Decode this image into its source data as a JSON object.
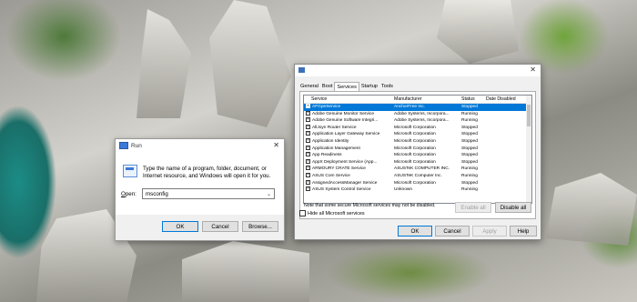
{
  "run_dialog": {
    "title": "Run",
    "message": "Type the name of a program, folder, document, or Internet resource, and Windows will open it for you.",
    "open_label": "Open:",
    "open_value": "msconfig",
    "ok": "OK",
    "cancel": "Cancel",
    "browse": "Browse..."
  },
  "msconfig": {
    "tabs": [
      "General",
      "Boot",
      "Services",
      "Startup",
      "Tools"
    ],
    "active_tab": "Services",
    "columns": [
      "Service",
      "Manufacturer",
      "Status",
      "Date Disabled"
    ],
    "services": [
      {
        "name": "AFGpeService",
        "manufacturer": "AnchorFree Inc.",
        "status": "Stopped",
        "selected": true
      },
      {
        "name": "Adobe Genuine Monitor Service",
        "manufacturer": "Adobe Systems, Incorpora...",
        "status": "Running"
      },
      {
        "name": "Adobe Genuine Software Integri...",
        "manufacturer": "Adobe Systems, Incorpora...",
        "status": "Running"
      },
      {
        "name": "AllJoyn Router Service",
        "manufacturer": "Microsoft Corporation",
        "status": "Stopped"
      },
      {
        "name": "Application Layer Gateway Service",
        "manufacturer": "Microsoft Corporation",
        "status": "Stopped"
      },
      {
        "name": "Application Identity",
        "manufacturer": "Microsoft Corporation",
        "status": "Stopped"
      },
      {
        "name": "Application Management",
        "manufacturer": "Microsoft Corporation",
        "status": "Stopped"
      },
      {
        "name": "App Readiness",
        "manufacturer": "Microsoft Corporation",
        "status": "Stopped"
      },
      {
        "name": "AppX Deployment Service (App...",
        "manufacturer": "Microsoft Corporation",
        "status": "Stopped"
      },
      {
        "name": "ARMOURY CRATE Service",
        "manufacturer": "ASUSTeK COMPUTER INC.",
        "status": "Running"
      },
      {
        "name": "ASUS Com Service",
        "manufacturer": "ASUSTeK Computer Inc.",
        "status": "Running"
      },
      {
        "name": "AssignedAccessManager Service",
        "manufacturer": "Microsoft Corporation",
        "status": "Stopped"
      },
      {
        "name": "ASUS System Control Service",
        "manufacturer": "Unknown",
        "status": "Running"
      }
    ],
    "note": "Note that some secure Microsoft services may not be disabled.",
    "enable_all": "Enable all",
    "disable_all": "Disable all",
    "hide_ms": "Hide all Microsoft services",
    "ok": "OK",
    "cancel": "Cancel",
    "apply": "Apply",
    "help": "Help"
  }
}
